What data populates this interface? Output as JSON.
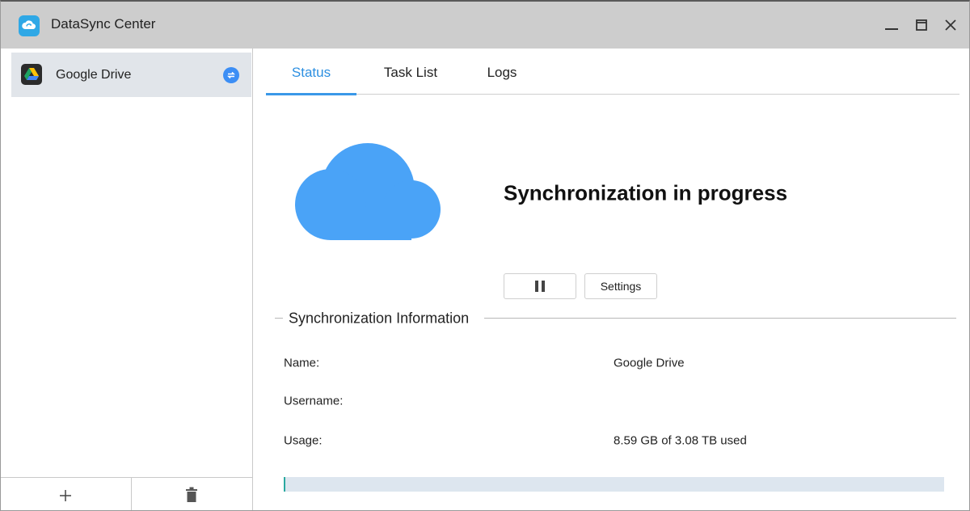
{
  "window": {
    "title": "DataSync Center",
    "app_icon": "sync-cloud-icon",
    "controls": [
      "minimize-icon",
      "maximize-icon",
      "close-icon"
    ]
  },
  "sidebar": {
    "items": [
      {
        "label": "Google Drive",
        "icon": "google-drive-icon",
        "badge_icon": "sync-status-icon",
        "selected": true
      }
    ],
    "footer": {
      "add_icon": "plus-icon",
      "delete_icon": "trash-icon"
    }
  },
  "tabs": [
    {
      "label": "Status",
      "active": true
    },
    {
      "label": "Task List",
      "active": false
    },
    {
      "label": "Logs",
      "active": false
    }
  ],
  "status": {
    "icon": "cloud-icon",
    "heading": "Synchronization in progress",
    "pause_icon": "pause-icon",
    "settings_label": "Settings"
  },
  "info": {
    "section_title": "Synchronization Information",
    "rows": [
      {
        "label": "Name:",
        "value": "Google Drive"
      },
      {
        "label": "Username:",
        "value": ""
      },
      {
        "label": "Usage:",
        "value": "8.59 GB of 3.08 TB used"
      }
    ],
    "usage_fraction": 0.0027
  },
  "colors": {
    "accent": "#2c8fe1",
    "cloud": "#4aa3f7",
    "titlebar": "#cdcdcd",
    "selected_item": "#e1e5ea",
    "usage_track": "#dde6ef",
    "usage_fill": "#2aa9a0"
  }
}
